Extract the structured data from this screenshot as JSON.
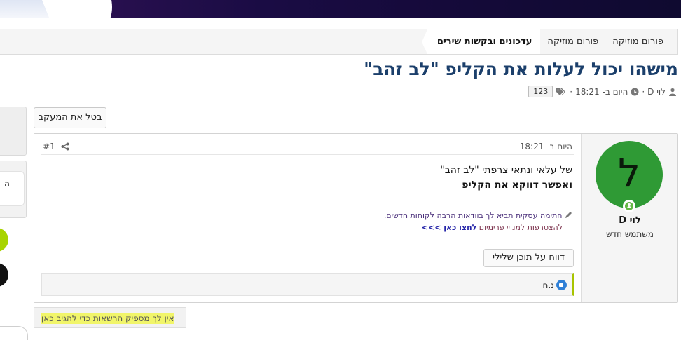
{
  "breadcrumb": {
    "items": [
      "פורום מוזיקה",
      "פורום מוזיקה",
      "עדכונים ובקשות שירים"
    ]
  },
  "thread": {
    "title": "מישהו יכול לעלות את הקליפ \"לב זהב\"",
    "author": "לוי D",
    "date": "היום ב- 18:21",
    "tag": "123",
    "separator": "·",
    "unwatch_label": "בטל את המעקב"
  },
  "message": {
    "date": "היום ב- 18:21",
    "number": "#1",
    "user": {
      "avatar_letter": "ל",
      "avatar_color": "#2f9a35",
      "name": "לוי D",
      "title": "משתמש חדש"
    },
    "body_line1": "של עלאי ונתאי צרפתי \"לב זהב\"",
    "body_line2": "ואפשר דווקא את הקליפ",
    "signature_line1": "חתימה עסקית תביא לך בוודאות הרבה לקוחות חדשים.",
    "signature_line2_prefix": "להצטרפות למנויי פרימיום",
    "signature_line2_link": "לחצו כאן >>>",
    "report_label": "דווח על תוכן שלילי",
    "reaction_user": "נ.ח"
  },
  "no_permission": "אין לך מספיק הרשאות כדי להגיב כאן",
  "side": {
    "snippet": "ה"
  },
  "colors": {
    "accent_green": "#2f9a35",
    "title_blue": "#1b3f6b",
    "highlight": "#f1f56a"
  }
}
